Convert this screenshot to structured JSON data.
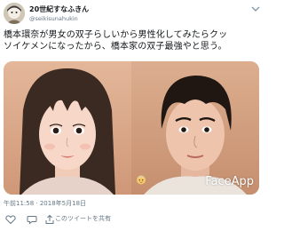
{
  "user": {
    "display_name": "20世紀すなふきん",
    "handle": "@seikisunahukin"
  },
  "tweet": {
    "lines": [
      "橋本環奈が男女の双子らしいから男性化してみたらクッ",
      "ソイケメンになったから、橋本家の双子最強やと思う。"
    ]
  },
  "media": {
    "watermark": "FaceApp",
    "emoji": "man-emoji"
  },
  "meta": {
    "timestamp": "午前11:58 · 2018年5月18日"
  },
  "actions": {
    "share_label": "このツイートを共有",
    "icons": [
      "heart-icon",
      "comment-icon"
    ]
  },
  "colors": {
    "text": "#14171a",
    "muted": "#657786"
  }
}
